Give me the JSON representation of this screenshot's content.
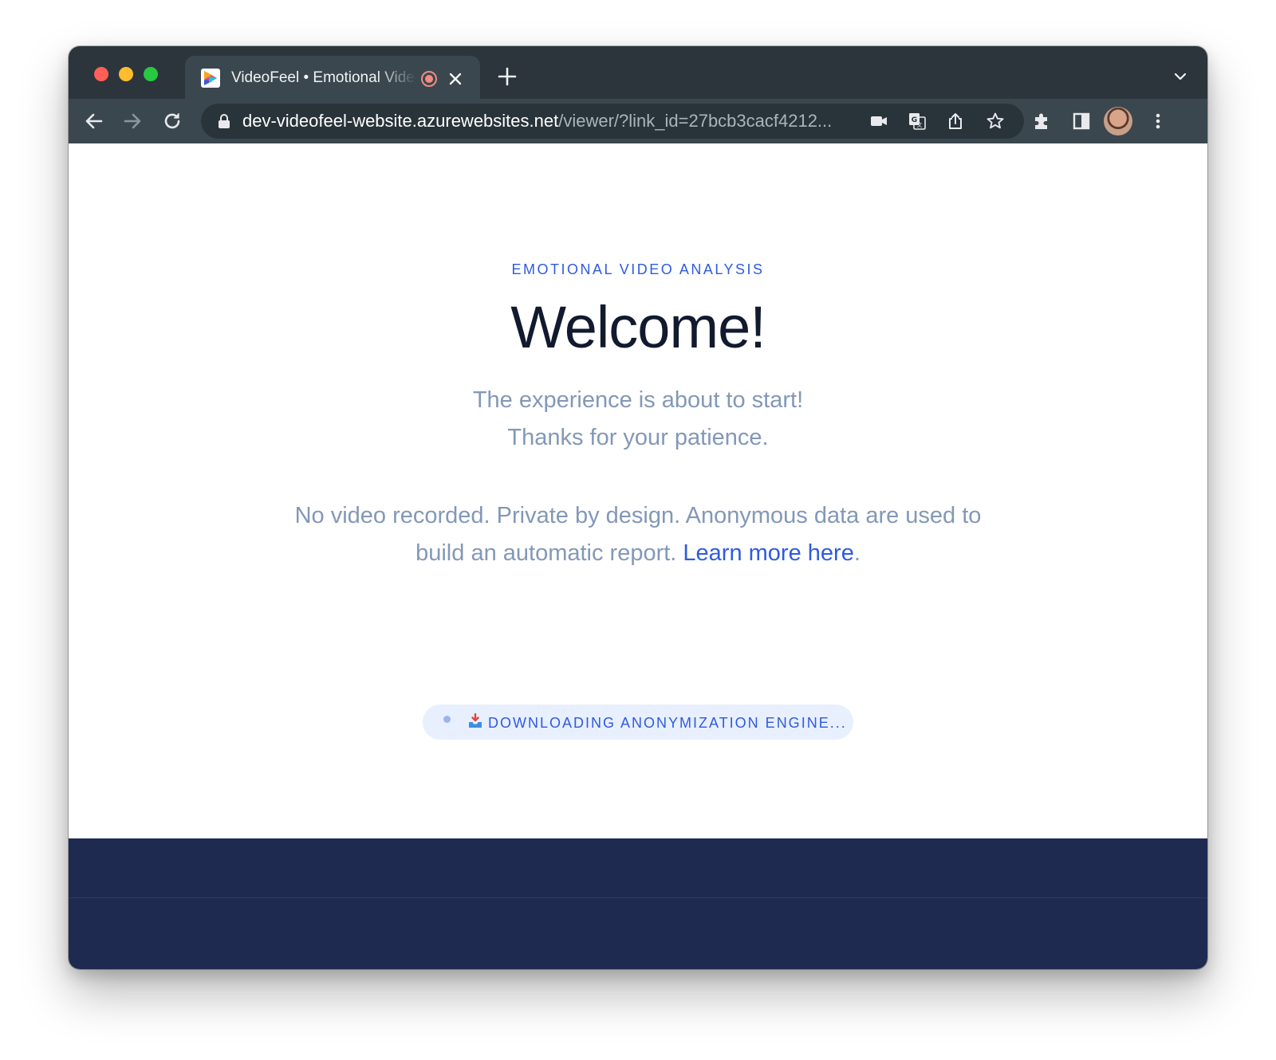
{
  "browser": {
    "tab": {
      "title": "VideoFeel • Emotional Video Analysis",
      "favicon": "videofeel-logo-icon",
      "recording_indicator": "recording-icon"
    },
    "address_bar": {
      "host": "dev-videofeel-website.azurewebsites.net",
      "path": "/viewer/?link_id=27bcb3cacf4212..."
    },
    "colors": {
      "tabstrip": "#2b353b",
      "toolbar": "#3b474e"
    }
  },
  "page": {
    "eyebrow": "EMOTIONAL VIDEO ANALYSIS",
    "title": "Welcome!",
    "subtitle_line1": "The experience is about to start!",
    "subtitle_line2": "Thanks for your patience.",
    "privacy_text": "No video recorded. Private by design. Anonymous data are used to build an automatic report.",
    "privacy_link": "Learn more here",
    "privacy_period": ".",
    "status": "DOWNLOADING ANONYMIZATION ENGINE...",
    "colors": {
      "accent": "#2f5be0",
      "heading": "#111a2e",
      "muted": "#8398b7",
      "pill_bg": "#e8efff",
      "footer": "#1e2a4f"
    }
  }
}
